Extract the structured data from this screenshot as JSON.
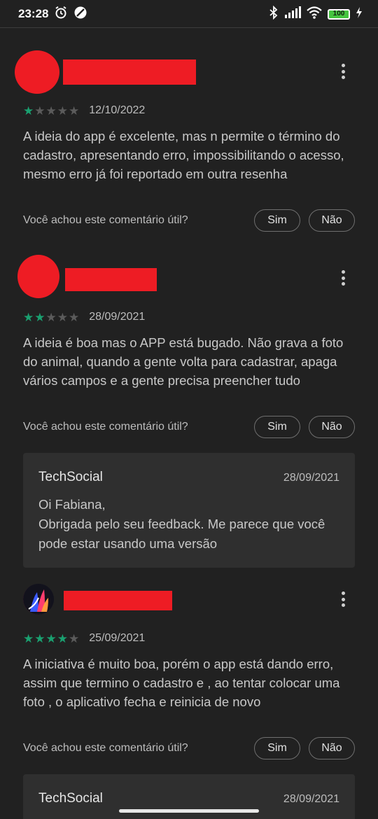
{
  "status_bar": {
    "time": "23:28",
    "battery": "100"
  },
  "reviews": [
    {
      "rating": 1,
      "date": "12/10/2022",
      "text": "A ideia do app é excelente, mas n permite o término do cadastro, apresentando erro, impossibilitando o acesso, mesmo erro já foi reportado em outra resenha",
      "helpful_question": "Você achou este comentário útil?",
      "yes_label": "Sim",
      "no_label": "Não"
    },
    {
      "rating": 2,
      "date": "28/09/2021",
      "text": "A ideia é boa mas o APP está bugado. Não grava a foto do animal, quando a gente volta para cadastrar, apaga vários campos e a gente precisa preencher tudo",
      "helpful_question": "Você achou este comentário útil?",
      "yes_label": "Sim",
      "no_label": "Não",
      "reply": {
        "developer": "TechSocial",
        "date": "28/09/2021",
        "text": "Oi Fabiana,\nObrigada pelo seu feedback. Me parece que você pode estar usando uma versão"
      }
    },
    {
      "rating": 4,
      "date": "25/09/2021",
      "text": "A iniciativa é muito boa, porém o app está dando erro, assim que termino o cadastro e , ao tentar colocar uma foto , o aplicativo fecha e reinicia de novo",
      "helpful_question": "Você achou este comentário útil?",
      "yes_label": "Sim",
      "no_label": "Não",
      "reply": {
        "developer": "TechSocial",
        "date": "28/09/2021"
      }
    }
  ],
  "colors": {
    "background": "#212121",
    "star_filled": "#1aa070",
    "star_empty": "#5b5b5b",
    "redaction": "#ee1c24",
    "reply_card": "#2f2f2f"
  }
}
